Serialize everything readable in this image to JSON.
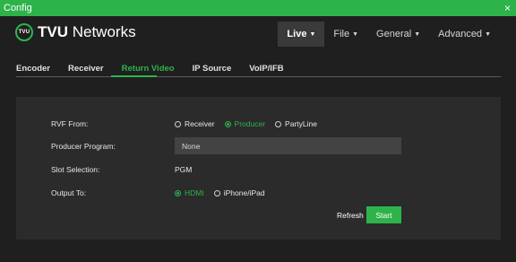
{
  "window": {
    "title": "Config",
    "close_glyph": "×"
  },
  "brand": {
    "logo_text": "TVU",
    "name_bold": "TVU",
    "name_rest": " Networks"
  },
  "topnav": [
    {
      "label": "Live",
      "active": true
    },
    {
      "label": "File"
    },
    {
      "label": "General"
    },
    {
      "label": "Advanced"
    }
  ],
  "tabs": [
    {
      "label": "Encoder"
    },
    {
      "label": "Receiver"
    },
    {
      "label": "Return Video",
      "active": true
    },
    {
      "label": "IP Source"
    },
    {
      "label": "VoIP/IFB"
    }
  ],
  "form": {
    "rvf_from": {
      "label": "RVF From:",
      "options": [
        "Receiver",
        "Producer",
        "PartyLine"
      ],
      "selected": "Producer"
    },
    "producer_program": {
      "label": "Producer Program:",
      "value": "None"
    },
    "slot_selection": {
      "label": "Slot Selection:",
      "value": "PGM"
    },
    "output_to": {
      "label": "Output To:",
      "options": [
        "HDMI",
        "iPhone/iPad"
      ],
      "selected": "HDMI"
    }
  },
  "actions": {
    "refresh": "Refresh",
    "start": "Start"
  },
  "colors": {
    "accent": "#2eb34b",
    "background": "#1f1f1f",
    "panel": "#2b2b2b"
  }
}
